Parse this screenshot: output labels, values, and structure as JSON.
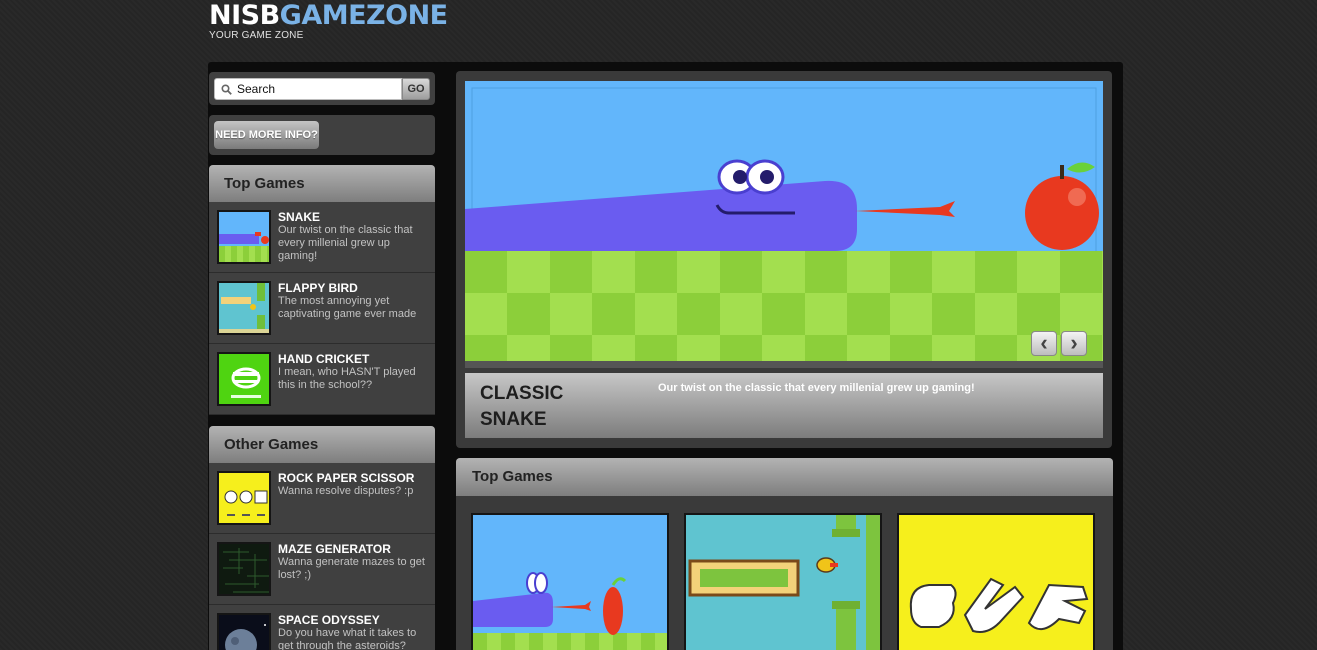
{
  "header": {
    "logo_part1": "NISB",
    "logo_part2": "GAMEZONE",
    "tagline": "YOUR GAME ZONE"
  },
  "search": {
    "placeholder": "Search",
    "go_label": "GO"
  },
  "info_button": "NEED MORE INFO?",
  "sidebar_top_games": {
    "title": "Top Games",
    "items": [
      {
        "title": "SNAKE",
        "desc": "Our twist on the classic that every millenial grew up gaming!",
        "icon": "snake-thumbnail"
      },
      {
        "title": "FLAPPY BIRD",
        "desc": "The most annoying yet captivating game ever made",
        "icon": "flappy-bird-thumbnail"
      },
      {
        "title": "HAND CRICKET",
        "desc": "I mean, who HASN'T played this in the school??",
        "icon": "hand-cricket-thumbnail"
      }
    ]
  },
  "sidebar_other_games": {
    "title": "Other Games",
    "items": [
      {
        "title": "ROCK PAPER SCISSOR",
        "desc": "Wanna resolve disputes? :p",
        "icon": "rock-paper-scissor-thumbnail"
      },
      {
        "title": "MAZE GENERATOR",
        "desc": "Wanna generate mazes to get lost? ;)",
        "icon": "maze-thumbnail"
      },
      {
        "title": "SPACE ODYSSEY",
        "desc": "Do you have what it takes to get through the asteroids?",
        "icon": "space-thumbnail"
      }
    ]
  },
  "slider": {
    "caption_title": "CLASSIC SNAKE",
    "caption_desc": "Our twist on the classic that every millenial grew up gaming!",
    "prev_icon": "chevron-left-icon",
    "next_icon": "chevron-right-icon"
  },
  "top_games_grid": {
    "title": "Top Games"
  },
  "colors": {
    "background": "#262626",
    "logo_accent": "#7ab2e6",
    "snake_purple": "#6a5cf0",
    "grass_light": "#a3df4f",
    "grass_dark": "#8ccf3a",
    "sky_blue": "#62b6fb",
    "apple_red": "#e8391f",
    "hand_cricket_green": "#4fd411",
    "rps_yellow": "#f6ef1c"
  }
}
